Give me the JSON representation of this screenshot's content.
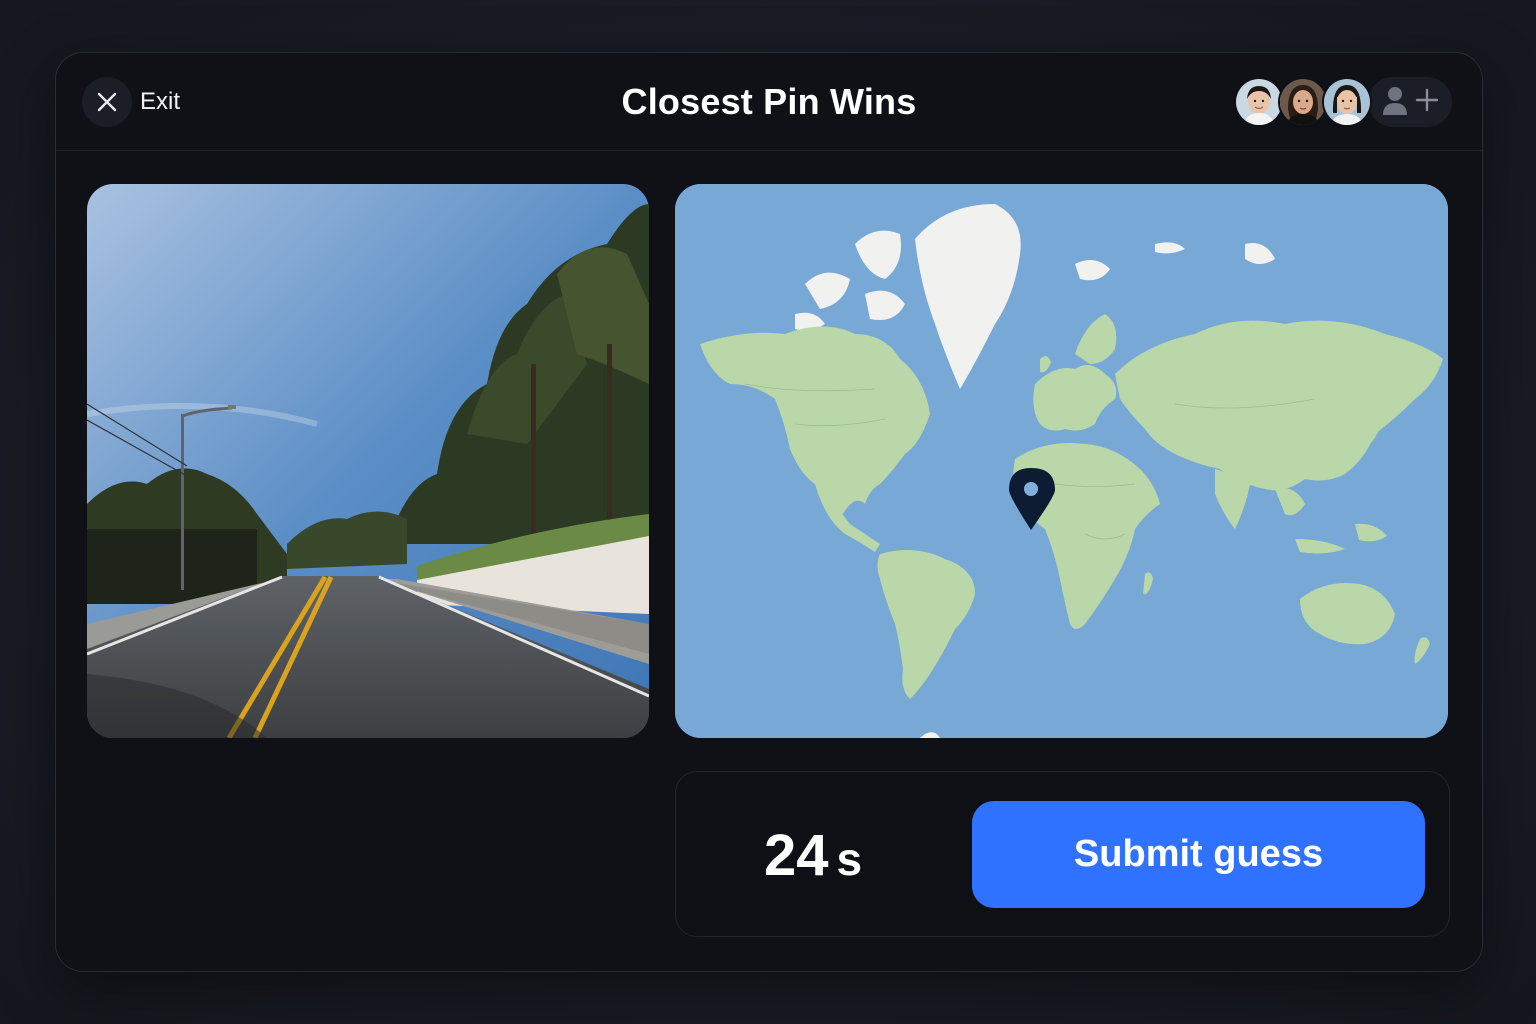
{
  "header": {
    "exit_label": "Exit",
    "title": "Closest Pin Wins"
  },
  "players": [
    {
      "icon": "avatar-1"
    },
    {
      "icon": "avatar-2"
    },
    {
      "icon": "avatar-3"
    }
  ],
  "invite": {
    "icon": "add-player-icon"
  },
  "street_view": {
    "icon": "street-view-photo"
  },
  "map": {
    "icon": "world-map",
    "pin_icon": "location-pin-icon"
  },
  "timer": {
    "value": "24",
    "unit": "s"
  },
  "submit": {
    "label": "Submit guess"
  },
  "colors": {
    "accent": "#2f72ff",
    "background": "#0f1117",
    "ocean": "#78a9d6",
    "land": "#b9d7a8"
  }
}
